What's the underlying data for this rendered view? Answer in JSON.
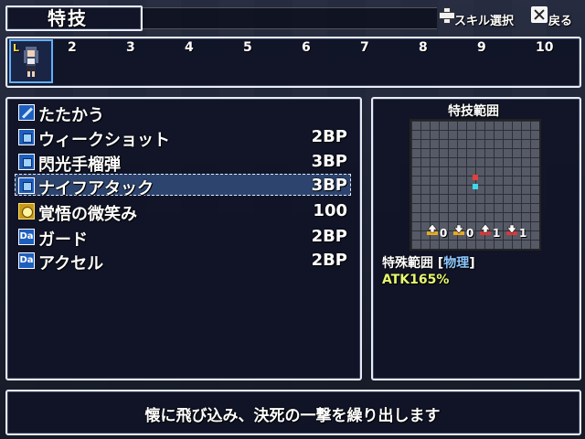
{
  "header": {
    "title": "特技",
    "skill_select_hint": "スキル選択",
    "back_hint": "戻る"
  },
  "party": {
    "leader_mark": "L",
    "slot_numbers": [
      "2",
      "3",
      "4",
      "5",
      "6",
      "7",
      "8",
      "9",
      "10"
    ]
  },
  "skills": [
    {
      "name": "たたかう",
      "cost": "",
      "icon": "attack-icon"
    },
    {
      "name": "ウィークショット",
      "cost": "2BP",
      "icon": "skill-icon"
    },
    {
      "name": "閃光手榴弾",
      "cost": "3BP",
      "icon": "skill-icon"
    },
    {
      "name": "ナイフアタック",
      "cost": "3BP",
      "icon": "skill-icon",
      "selected": true
    },
    {
      "name": "覚悟の微笑み",
      "cost": "100",
      "icon": "special-gold-icon"
    },
    {
      "name": "ガード",
      "cost": "2BP",
      "icon": "da-icon"
    },
    {
      "name": "アクセル",
      "cost": "2BP",
      "icon": "da-icon"
    }
  ],
  "da_label": "Da",
  "range": {
    "title": "特技範囲",
    "indicators": [
      "0",
      "0",
      "1",
      "1"
    ],
    "type_label": "特殊範囲",
    "attribute": "物理",
    "bracket_open": "[",
    "bracket_close": "]",
    "atk": "ATK165%"
  },
  "description": "懐に飛び込み、決死の一撃を繰り出します",
  "colors": {
    "panel_bg": "#101426",
    "border": "#e8ecf4",
    "cursor": "#466eaa",
    "attribute": "#8ec8ff",
    "atk": "#e8f870",
    "grid_red": "#e04040",
    "grid_cyan": "#40d8e8"
  }
}
